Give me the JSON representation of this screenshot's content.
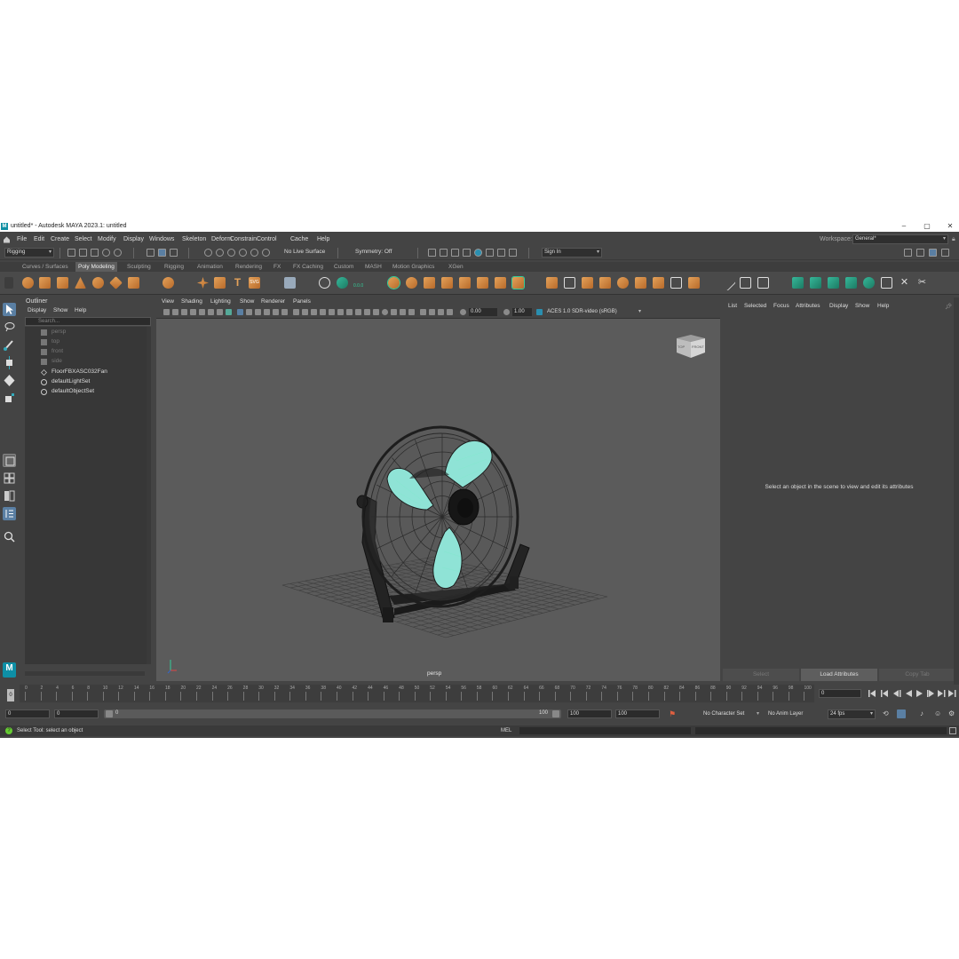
{
  "window": {
    "title": "untitled* - Autodesk MAYA 2023.1: untitled",
    "logo": "M"
  },
  "menubar": [
    "File",
    "Edit",
    "Create",
    "Select",
    "Modify",
    "Display",
    "Windows",
    "Skeleton",
    "Deform",
    "Constrain",
    "Control",
    "Cache",
    "Help"
  ],
  "workspace": {
    "label": "Workspace:",
    "value": "General*"
  },
  "status_line": {
    "mode": "Rigging",
    "live_surface": "No Live Surface",
    "symmetry": "Symmetry: Off",
    "sign_in": "Sign In"
  },
  "shelf_tabs": [
    "Curves / Surfaces",
    "Poly Modeling",
    "Sculpting",
    "Rigging",
    "Animation",
    "Rendering",
    "FX",
    "FX Caching",
    "Custom",
    "MASH",
    "Motion Graphics",
    "XGen"
  ],
  "shelf_active": "Poly Modeling",
  "outliner": {
    "title": "Outliner",
    "menu": [
      "Display",
      "Show",
      "Help"
    ],
    "search_placeholder": "Search...",
    "items": [
      "persp",
      "top",
      "front",
      "side",
      "FloorFBXASC032Fan",
      "defaultLightSet",
      "defaultObjectSet"
    ]
  },
  "viewport": {
    "menu": [
      "View",
      "Shading",
      "Lighting",
      "Show",
      "Renderer",
      "Panels"
    ],
    "exposure": "0.00",
    "gamma": "1.00",
    "color_space": "ACES 1.0 SDR-video (sRGB)",
    "camera_label": "persp",
    "viewcube": {
      "top": "TOP",
      "front": "FRONT"
    }
  },
  "attribute_editor": {
    "menu": [
      "List",
      "Selected",
      "Focus",
      "Attributes",
      "Display",
      "Show",
      "Help"
    ],
    "message": "Select an object in the scene to view and edit its attributes",
    "buttons": [
      "Select",
      "Load Attributes",
      "Copy Tab"
    ]
  },
  "timeslider": {
    "ticks": [
      "0",
      "2",
      "4",
      "6",
      "8",
      "10",
      "12",
      "14",
      "16",
      "18",
      "20",
      "22",
      "24",
      "26",
      "28",
      "30",
      "32",
      "34",
      "36",
      "38",
      "40",
      "42",
      "44",
      "46",
      "48",
      "50",
      "52",
      "54",
      "56",
      "58",
      "60",
      "62",
      "64",
      "66",
      "68",
      "70",
      "72",
      "74",
      "76",
      "78",
      "80",
      "82",
      "84",
      "86",
      "88",
      "90",
      "92",
      "94",
      "96",
      "98",
      "100"
    ],
    "current_frame": "0",
    "frame_marker": "0"
  },
  "range_slider": {
    "start": "0",
    "playback_start": "0",
    "slider_start": "0",
    "slider_end": "100",
    "playback_end": "100",
    "end": "100",
    "character_set": "No Character Set",
    "anim_layer": "No Anim Layer",
    "fps": "24 fps"
  },
  "help_line": {
    "text": "Select Tool: select an object",
    "mel_label": "MEL"
  },
  "colors": {
    "panel": "#444444",
    "viewport": "#5b5b5b",
    "accent": "#0e8fa6",
    "shelf_orange": "#e4a25a",
    "fan_blade": "#8fe3d6"
  }
}
